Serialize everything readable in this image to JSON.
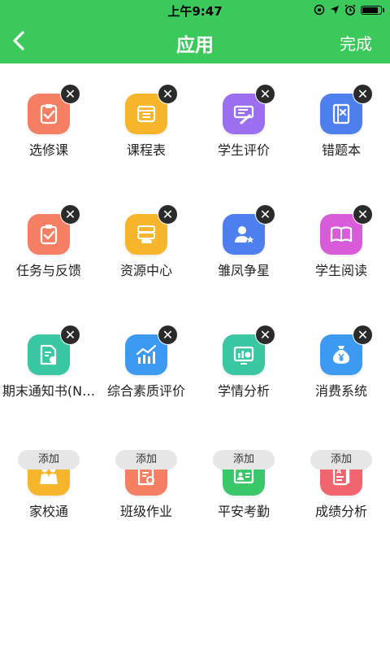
{
  "status_bar": {
    "time": "上午9:47",
    "icons": [
      "lock-rotation-icon",
      "location-icon",
      "alarm-icon",
      "battery-icon"
    ]
  },
  "nav": {
    "title": "应用",
    "back_icon": "chevron-left-icon",
    "done_label": "完成"
  },
  "colors": {
    "brand": "#3cc95c"
  },
  "installed_apps": [
    {
      "label": "选修课",
      "icon": "clipboard-check-icon",
      "color": "#f57f63"
    },
    {
      "label": "课程表",
      "icon": "timetable-icon",
      "color": "#f7b52b"
    },
    {
      "label": "学生评价",
      "icon": "pen-evaluation-icon",
      "color": "#9b6ff0"
    },
    {
      "label": "错题本",
      "icon": "error-notebook-icon",
      "color": "#4d80ee"
    },
    {
      "label": "任务与反馈",
      "icon": "task-feedback-icon",
      "color": "#f57f63"
    },
    {
      "label": "资源中心",
      "icon": "cloud-server-icon",
      "color": "#f7b52b"
    },
    {
      "label": "雏凤争星",
      "icon": "user-star-icon",
      "color": "#4d80ee"
    },
    {
      "label": "学生阅读",
      "icon": "open-book-icon",
      "color": "#d85bd9"
    },
    {
      "label": "期末通知书(N…",
      "icon": "certificate-icon",
      "color": "#3ac7a3"
    },
    {
      "label": "综合素质评价",
      "icon": "trend-chart-icon",
      "color": "#3d9af2"
    },
    {
      "label": "学情分析",
      "icon": "analysis-board-icon",
      "color": "#3ac7a3"
    },
    {
      "label": "消费系统",
      "icon": "money-bag-icon",
      "color": "#3d9af2"
    }
  ],
  "available_apps": [
    {
      "label": "家校通",
      "icon": "family-icon",
      "color": "#f7b52b",
      "add_label": "添加"
    },
    {
      "label": "班级作业",
      "icon": "homework-icon",
      "color": "#f57f63",
      "add_label": "添加"
    },
    {
      "label": "平安考勤",
      "icon": "id-card-icon",
      "color": "#3ac76a",
      "add_label": "添加"
    },
    {
      "label": "成绩分析",
      "icon": "grade-report-icon",
      "color": "#f2646e",
      "add_label": "添加"
    }
  ],
  "remove_symbol": "✕"
}
